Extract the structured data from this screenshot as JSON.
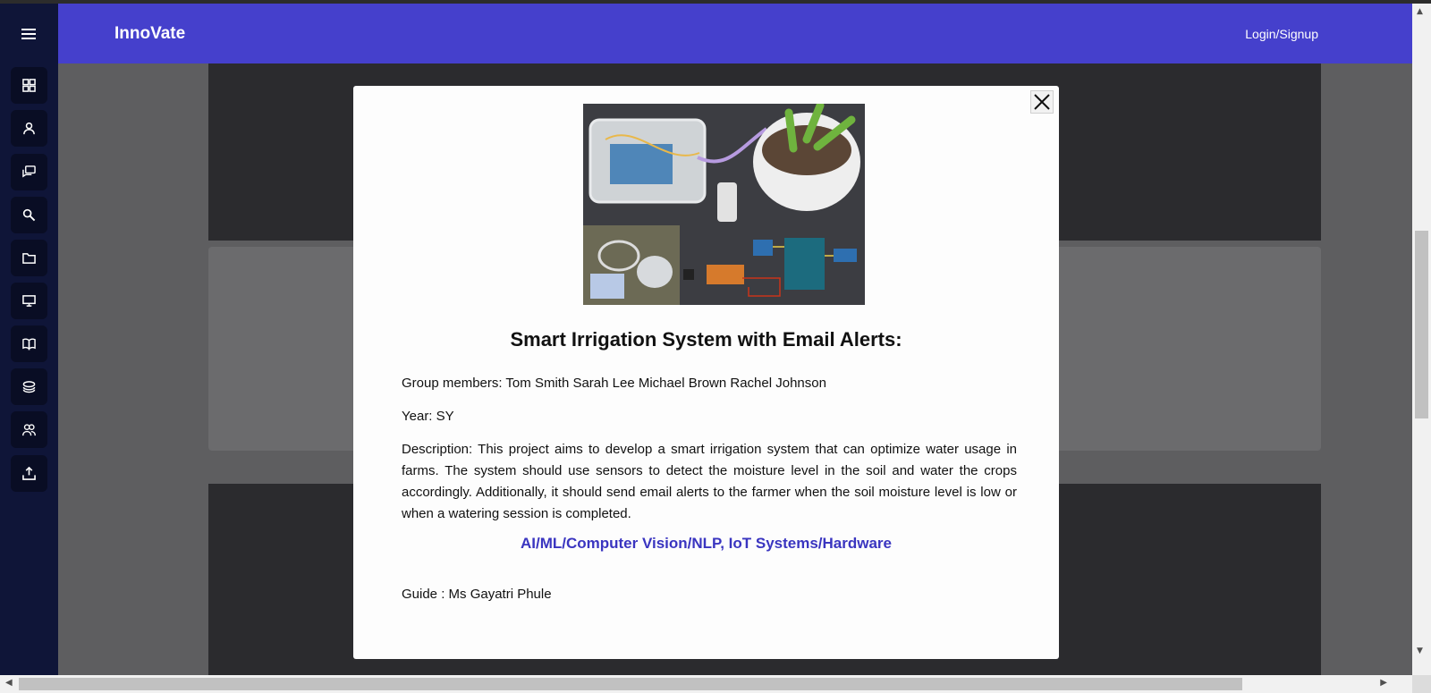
{
  "app": {
    "brand": "InnoVate",
    "login_label": "Login/Signup"
  },
  "sidebar": {
    "items": [
      {
        "icon": "grid-icon"
      },
      {
        "icon": "user-icon"
      },
      {
        "icon": "chat-icon"
      },
      {
        "icon": "search-icon"
      },
      {
        "icon": "folder-icon"
      },
      {
        "icon": "monitor-icon"
      },
      {
        "icon": "book-icon"
      },
      {
        "icon": "layers-icon"
      },
      {
        "icon": "users-icon"
      },
      {
        "icon": "upload-icon"
      }
    ]
  },
  "modal": {
    "title": "Smart Irrigation System with Email Alerts:",
    "group_members": "Group members: Tom Smith Sarah Lee Michael Brown Rachel Johnson",
    "year": "Year: SY",
    "description": "Description: This project aims to develop a smart irrigation system that can optimize water usage in farms. The system should use sensors to detect the moisture level in the soil and water the crops accordingly. Additionally, it should send email alerts to the farmer when the soil moisture level is low or when a watering session is completed.",
    "domains": "AI/ML/Computer Vision/NLP, IoT Systems/Hardware",
    "guide": "Guide : Ms Gayatri Phule"
  },
  "colors": {
    "topbar": "#4540cc",
    "sidebar": "#0f1538",
    "accent_link": "#3a35c0"
  }
}
